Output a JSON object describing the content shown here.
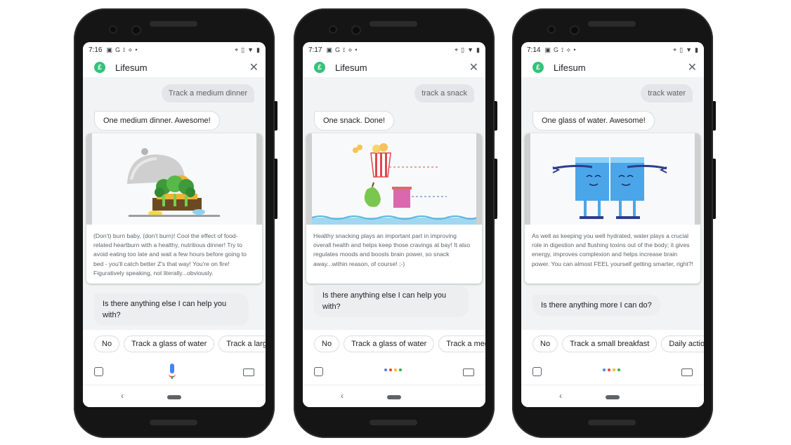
{
  "app_name": "Lifesum",
  "colors": {
    "brand": "#35c27a",
    "mic_blue": "#4285f4",
    "mic_red": "#ea4335",
    "mic_green": "#34a853",
    "mic_yellow": "#fbbc05"
  },
  "phones": [
    {
      "time": "7:16",
      "query": "Track a medium dinner",
      "response": "One medium dinner. Awesome!",
      "card_text": "(Don't) burn baby, (don't burn)! Cool the effect of food-related heartburn with a healthy, nutritious dinner! Try to avoid eating too late and wait a few hours before going to bed - you'll catch better Z's that way! You're on fire! Figuratively speaking, not literally...obviously.",
      "followup": "Is there anything else I can help you with?",
      "chips": [
        "No",
        "Track a glass of water",
        "Track a large"
      ],
      "mic_state": "listening"
    },
    {
      "time": "7:17",
      "query": "track a snack",
      "response": "One snack. Done!",
      "card_text": "Healthy snacking plays an important part in improving overall health and helps keep those cravings at bay! It also regulates moods and boosts brain power, so snack away...within reason, of course! ;-)",
      "followup": "Is there anything else I can help you with?",
      "chips": [
        "No",
        "Track a glass of water",
        "Track a med"
      ],
      "mic_state": "dots"
    },
    {
      "time": "7:14",
      "query": "track water",
      "response": "One glass of water. Awesome!",
      "card_text": "As well as keeping you well hydrated, water plays a crucial role in digestion and flushing toxins out of the body; it gives energy, improves complexion and helps increase brain power. You can almost FEEL yourself getting smarter, right?!",
      "followup": "Is there anything more I can do?",
      "chips": [
        "No",
        "Track a small breakfast",
        "Daily action"
      ],
      "mic_state": "dots"
    }
  ],
  "icons": {
    "logo": "£",
    "close": "✕",
    "back": "‹",
    "status_left": [
      "▣",
      "G",
      "⟟",
      "⟡",
      "•"
    ],
    "status_right": [
      "⌖",
      "▯",
      "▼",
      "▮"
    ]
  }
}
